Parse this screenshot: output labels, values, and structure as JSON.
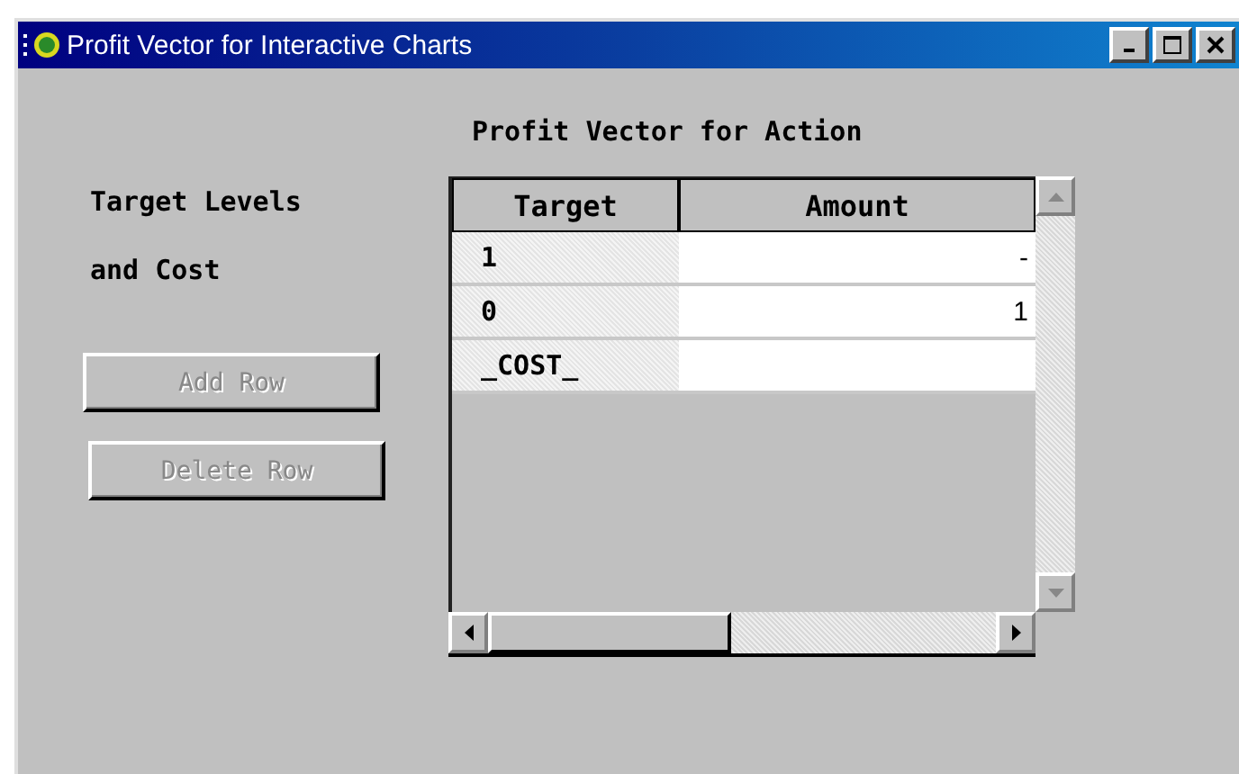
{
  "window": {
    "title": "Profit Vector for Interactive Charts"
  },
  "heading": "Profit Vector for Action",
  "label_lines": [
    "Target Levels",
    "and Cost"
  ],
  "buttons": [
    {
      "label": "Add Row",
      "disabled": true
    },
    {
      "label": "Delete Row",
      "disabled": true
    }
  ],
  "table": {
    "columns": [
      "Target",
      "Amount"
    ],
    "rows": [
      {
        "target": "1",
        "amount": "-"
      },
      {
        "target": "0",
        "amount": "1"
      },
      {
        "target": "_COST_"
      }
    ]
  }
}
